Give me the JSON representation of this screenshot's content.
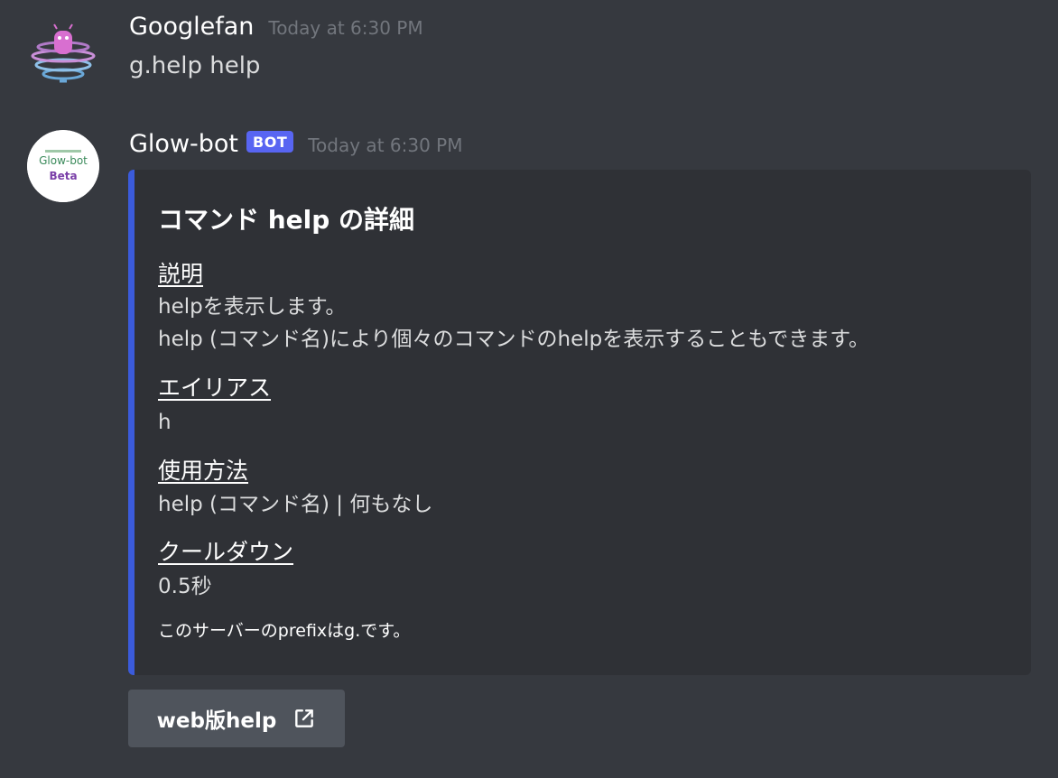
{
  "messages": [
    {
      "username": "Googlefan",
      "timestamp": "Today at 6:30 PM",
      "content": "g.help help"
    },
    {
      "username": "Glow-bot",
      "bot_tag": "BOT",
      "timestamp": "Today at 6:30 PM",
      "avatar_text": {
        "line1": "Glow-bot",
        "line2": "Beta"
      },
      "embed": {
        "accent_color": "#3b5bdb",
        "title": "コマンド help の詳細",
        "fields": [
          {
            "name": "説明",
            "value_lines": [
              "helpを表示します。",
              "help (コマンド名)により個々のコマンドのhelpを表示することもできます。"
            ]
          },
          {
            "name": "エイリアス",
            "value": "h"
          },
          {
            "name": "使用方法",
            "value": "help (コマンド名) | 何もなし"
          },
          {
            "name": "クールダウン",
            "value": "0.5秒"
          }
        ],
        "footer": "このサーバーのprefixはg.です。"
      },
      "button": {
        "label": "web版help",
        "icon": "external-link-icon"
      }
    }
  ],
  "colors": {
    "background": "#36393f",
    "embed_background": "#2f3136",
    "bot_tag": "#5865f2",
    "button": "#4f545c",
    "timestamp": "#72767d"
  }
}
